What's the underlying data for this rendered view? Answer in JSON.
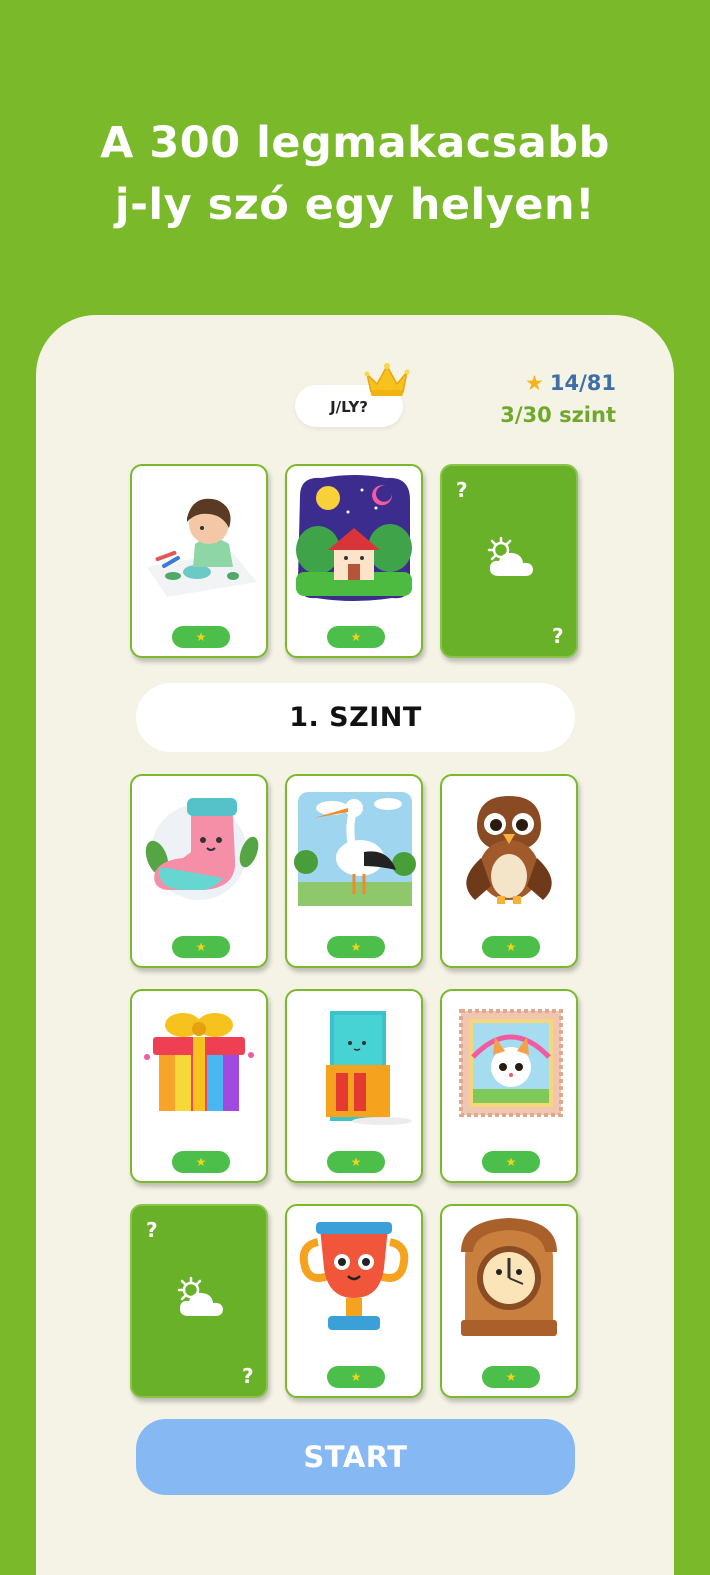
{
  "headline": {
    "line1": "A 300 legmakacsabb",
    "line2": "j-ly szó egy helyen!"
  },
  "logo": {
    "text": "J/LY?",
    "badge_icon": "crown-icon"
  },
  "stats": {
    "star_icon": "star-icon",
    "stars": "14/81",
    "level": "3/30 szint"
  },
  "level_banner": "1. SZINT",
  "cards_top": [
    {
      "picture": "boy-drawing-car",
      "state": "unlocked",
      "pill_icon": "star-icon"
    },
    {
      "picture": "house-under-night-sky",
      "state": "unlocked",
      "pill_icon": "star-icon"
    },
    {
      "picture": "weather-icon",
      "state": "locked",
      "mark": "?"
    }
  ],
  "cards_grid": [
    {
      "picture": "sock",
      "state": "unlocked",
      "pill_icon": "star-icon"
    },
    {
      "picture": "stork",
      "state": "unlocked",
      "pill_icon": "star-icon"
    },
    {
      "picture": "hawk",
      "state": "unlocked",
      "pill_icon": "star-icon"
    },
    {
      "picture": "gift-box",
      "state": "unlocked",
      "pill_icon": "star-icon"
    },
    {
      "picture": "door",
      "state": "unlocked",
      "pill_icon": "star-icon"
    },
    {
      "picture": "postage-stamp",
      "state": "unlocked",
      "pill_icon": "star-icon"
    },
    {
      "picture": "weather-icon",
      "state": "locked",
      "mark": "?"
    },
    {
      "picture": "trophy",
      "state": "unlocked",
      "pill_icon": "star-icon"
    },
    {
      "picture": "grandfather-clock",
      "state": "unlocked",
      "pill_icon": "star-icon"
    }
  ],
  "pill_star": "★",
  "start_label": "START",
  "colors": {
    "background": "#79b92a",
    "panel": "#f5f2e6",
    "card_border": "#79b92a",
    "locked_card": "#6ab12a",
    "pill": "#4bbf4a",
    "pill_star": "#f3d21c",
    "stars_text": "#3f6fa4",
    "level_text": "#6fa82b",
    "start_button": "#86b8f3"
  }
}
